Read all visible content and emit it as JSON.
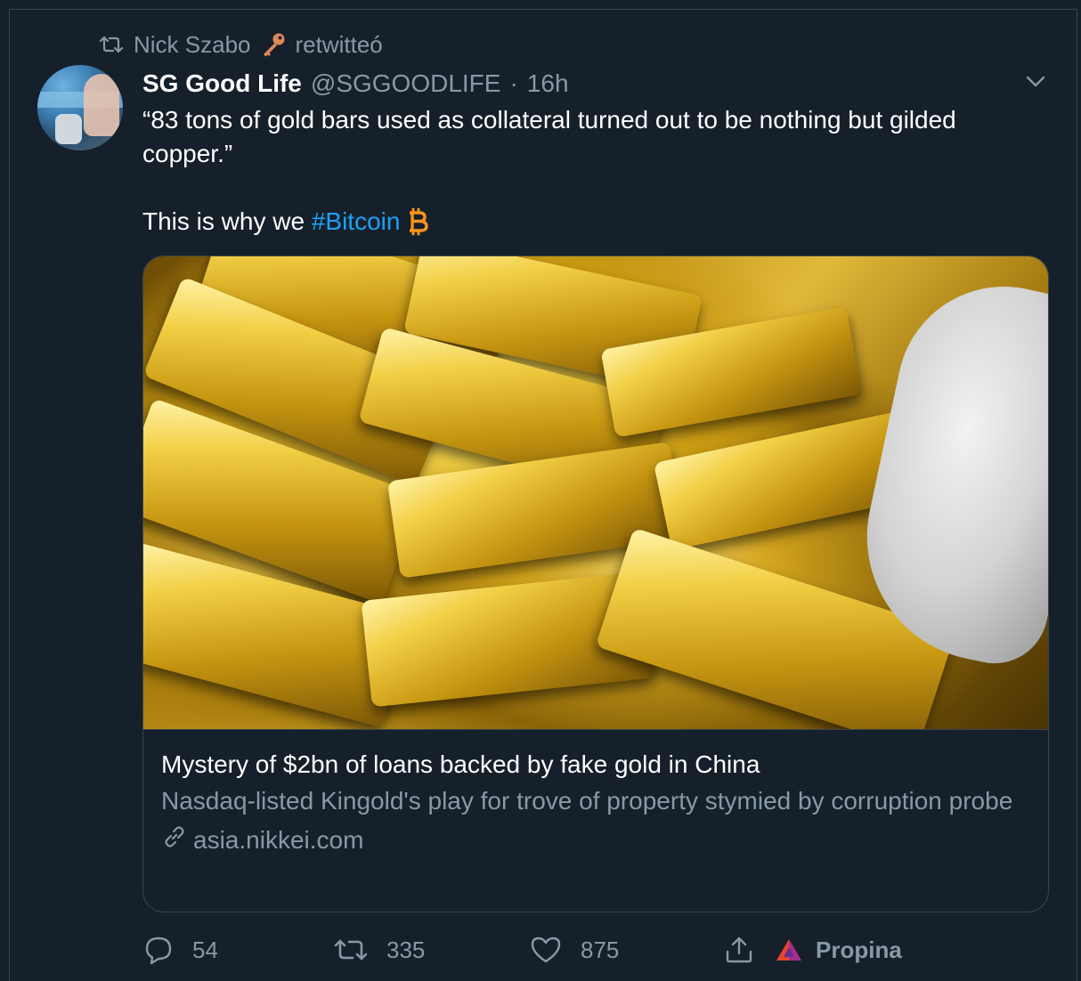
{
  "retweet": {
    "icon": "retweet-icon",
    "user": "Nick Szabo",
    "emoji_icon": "key-icon",
    "action": "retwitteó"
  },
  "tweet": {
    "display_name": "SG Good Life",
    "handle": "@SGGOODLIFE",
    "separator": "·",
    "time": "16h",
    "text_line1": "“83 tons of gold bars used as collateral turned out to be nothing but gilded copper.”",
    "text_line2_prefix": "This is why we ",
    "hashtag": "#Bitcoin",
    "emoji_icon": "bitcoin-icon"
  },
  "card": {
    "title": "Mystery of $2bn of loans backed by fake gold in China",
    "description": "Nasdaq-listed Kingold's play for trove of property stymied by corruption probe",
    "domain": "asia.nikkei.com",
    "domain_icon": "link-icon"
  },
  "actions": {
    "reply_count": "54",
    "retweet_count": "335",
    "like_count": "875",
    "tip_label": "Propina"
  },
  "colors": {
    "background": "#15202b",
    "border": "#38444d",
    "secondary_text": "#8899a6",
    "link": "#1da1f2",
    "bitcoin": "#f7931a"
  }
}
